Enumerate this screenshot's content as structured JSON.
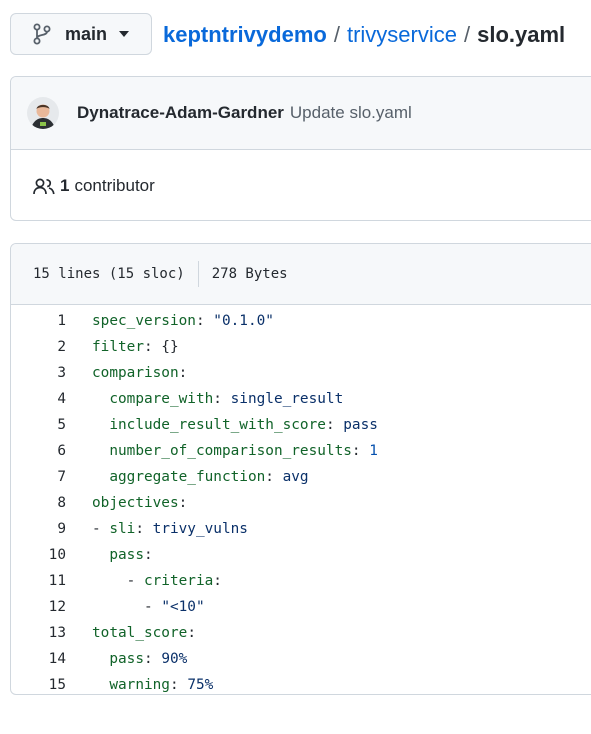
{
  "branch": {
    "label": "main",
    "icon": "git-branch-icon"
  },
  "breadcrumb": {
    "repo": "keptntrivydemo",
    "sep1": "/",
    "folder": "trivyservice",
    "sep2": "/",
    "file": "slo.yaml"
  },
  "commit": {
    "author": "Dynatrace-Adam-Gardner",
    "message": "Update slo.yaml"
  },
  "contributors": {
    "count": "1",
    "label": "contributor"
  },
  "file_info": {
    "lines": "15 lines (15 sloc)",
    "size": "278 Bytes"
  },
  "code": {
    "lines": [
      {
        "n": "1",
        "indent": "",
        "segs": [
          {
            "t": "spec_version",
            "k": "key"
          },
          {
            "t": ": ",
            "k": "punct"
          },
          {
            "t": "\"0.1.0\"",
            "k": "str"
          }
        ]
      },
      {
        "n": "2",
        "indent": "",
        "segs": [
          {
            "t": "filter",
            "k": "key"
          },
          {
            "t": ": {}",
            "k": "punct"
          }
        ]
      },
      {
        "n": "3",
        "indent": "",
        "segs": [
          {
            "t": "comparison",
            "k": "key"
          },
          {
            "t": ":",
            "k": "punct"
          }
        ]
      },
      {
        "n": "4",
        "indent": "  ",
        "segs": [
          {
            "t": "compare_with",
            "k": "key"
          },
          {
            "t": ": ",
            "k": "punct"
          },
          {
            "t": "single_result",
            "k": "str"
          }
        ]
      },
      {
        "n": "5",
        "indent": "  ",
        "segs": [
          {
            "t": "include_result_with_score",
            "k": "key"
          },
          {
            "t": ": ",
            "k": "punct"
          },
          {
            "t": "pass",
            "k": "str"
          }
        ]
      },
      {
        "n": "6",
        "indent": "  ",
        "segs": [
          {
            "t": "number_of_comparison_results",
            "k": "key"
          },
          {
            "t": ": ",
            "k": "punct"
          },
          {
            "t": "1",
            "k": "num"
          }
        ]
      },
      {
        "n": "7",
        "indent": "  ",
        "segs": [
          {
            "t": "aggregate_function",
            "k": "key"
          },
          {
            "t": ": ",
            "k": "punct"
          },
          {
            "t": "avg",
            "k": "str"
          }
        ]
      },
      {
        "n": "8",
        "indent": "",
        "segs": [
          {
            "t": "objectives",
            "k": "key"
          },
          {
            "t": ":",
            "k": "punct"
          }
        ]
      },
      {
        "n": "9",
        "indent": "",
        "segs": [
          {
            "t": "- ",
            "k": "punct"
          },
          {
            "t": "sli",
            "k": "key"
          },
          {
            "t": ": ",
            "k": "punct"
          },
          {
            "t": "trivy_vulns",
            "k": "str"
          }
        ]
      },
      {
        "n": "10",
        "indent": "  ",
        "segs": [
          {
            "t": "pass",
            "k": "key"
          },
          {
            "t": ":",
            "k": "punct"
          }
        ]
      },
      {
        "n": "11",
        "indent": "    ",
        "segs": [
          {
            "t": "- ",
            "k": "punct"
          },
          {
            "t": "criteria",
            "k": "key"
          },
          {
            "t": ":",
            "k": "punct"
          }
        ]
      },
      {
        "n": "12",
        "indent": "      ",
        "segs": [
          {
            "t": "- ",
            "k": "punct"
          },
          {
            "t": "\"<10\"",
            "k": "str"
          }
        ]
      },
      {
        "n": "13",
        "indent": "",
        "segs": [
          {
            "t": "total_score",
            "k": "key"
          },
          {
            "t": ":",
            "k": "punct"
          }
        ]
      },
      {
        "n": "14",
        "indent": "  ",
        "segs": [
          {
            "t": "pass",
            "k": "key"
          },
          {
            "t": ": ",
            "k": "punct"
          },
          {
            "t": "90%",
            "k": "str"
          }
        ]
      },
      {
        "n": "15",
        "indent": "  ",
        "segs": [
          {
            "t": "warning",
            "k": "key"
          },
          {
            "t": ": ",
            "k": "punct"
          },
          {
            "t": "75%",
            "k": "str"
          }
        ]
      }
    ]
  },
  "colors": {
    "link": "#0969da",
    "key": "#116329",
    "string": "#0a3069",
    "number": "#0550ae",
    "border": "#d0d7de",
    "header_bg": "#f6f8fa"
  }
}
